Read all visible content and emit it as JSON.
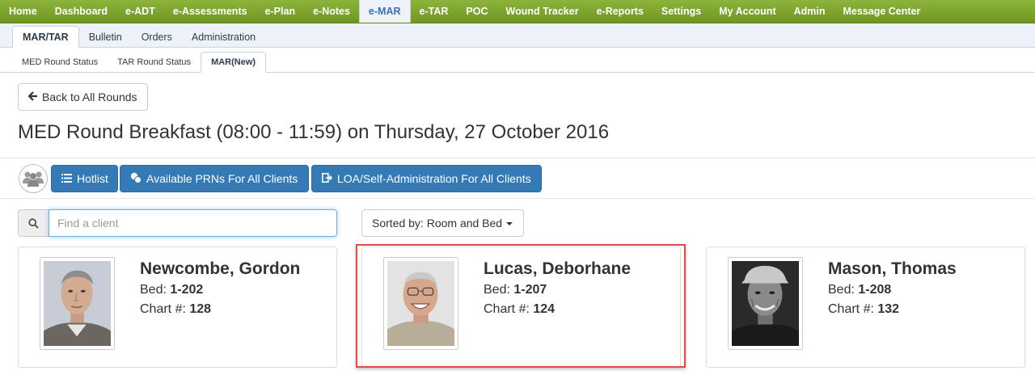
{
  "topnav": {
    "items": [
      "Home",
      "Dashboard",
      "e-ADT",
      "e-Assessments",
      "e-Plan",
      "e-Notes",
      "e-MAR",
      "e-TAR",
      "POC",
      "Wound Tracker",
      "e-Reports",
      "Settings",
      "My Account",
      "Admin",
      "Message Center"
    ],
    "active": "e-MAR"
  },
  "subnav": {
    "items": [
      "MAR/TAR",
      "Bulletin",
      "Orders",
      "Administration"
    ],
    "active": "MAR/TAR"
  },
  "thirdnav": {
    "items": [
      "MED Round Status",
      "TAR Round Status",
      "MAR(New)"
    ],
    "active": "MAR(New)"
  },
  "back_button": "Back to All Rounds",
  "page_title": "MED Round Breakfast (08:00 - 11:59) on Thursday, 27 October 2016",
  "toolbar": {
    "hotlist": "Hotlist",
    "prns": "Available PRNs For All Clients",
    "loa": "LOA/Self-Administration For All Clients"
  },
  "search": {
    "placeholder": "Find a client"
  },
  "sort": {
    "label": "Sorted by: Room and Bed"
  },
  "labels": {
    "bed": "Bed:",
    "chart": "Chart #:"
  },
  "clients": [
    {
      "name": "Newcombe, Gordon",
      "bed": "1-202",
      "chart": "128"
    },
    {
      "name": "Lucas, Deborhane",
      "bed": "1-207",
      "chart": "124"
    },
    {
      "name": "Mason, Thomas",
      "bed": "1-208",
      "chart": "132"
    }
  ],
  "colors": {
    "nav_green": "#7ba52d",
    "primary_blue": "#337ab7",
    "highlight_red": "#e04a4a"
  }
}
